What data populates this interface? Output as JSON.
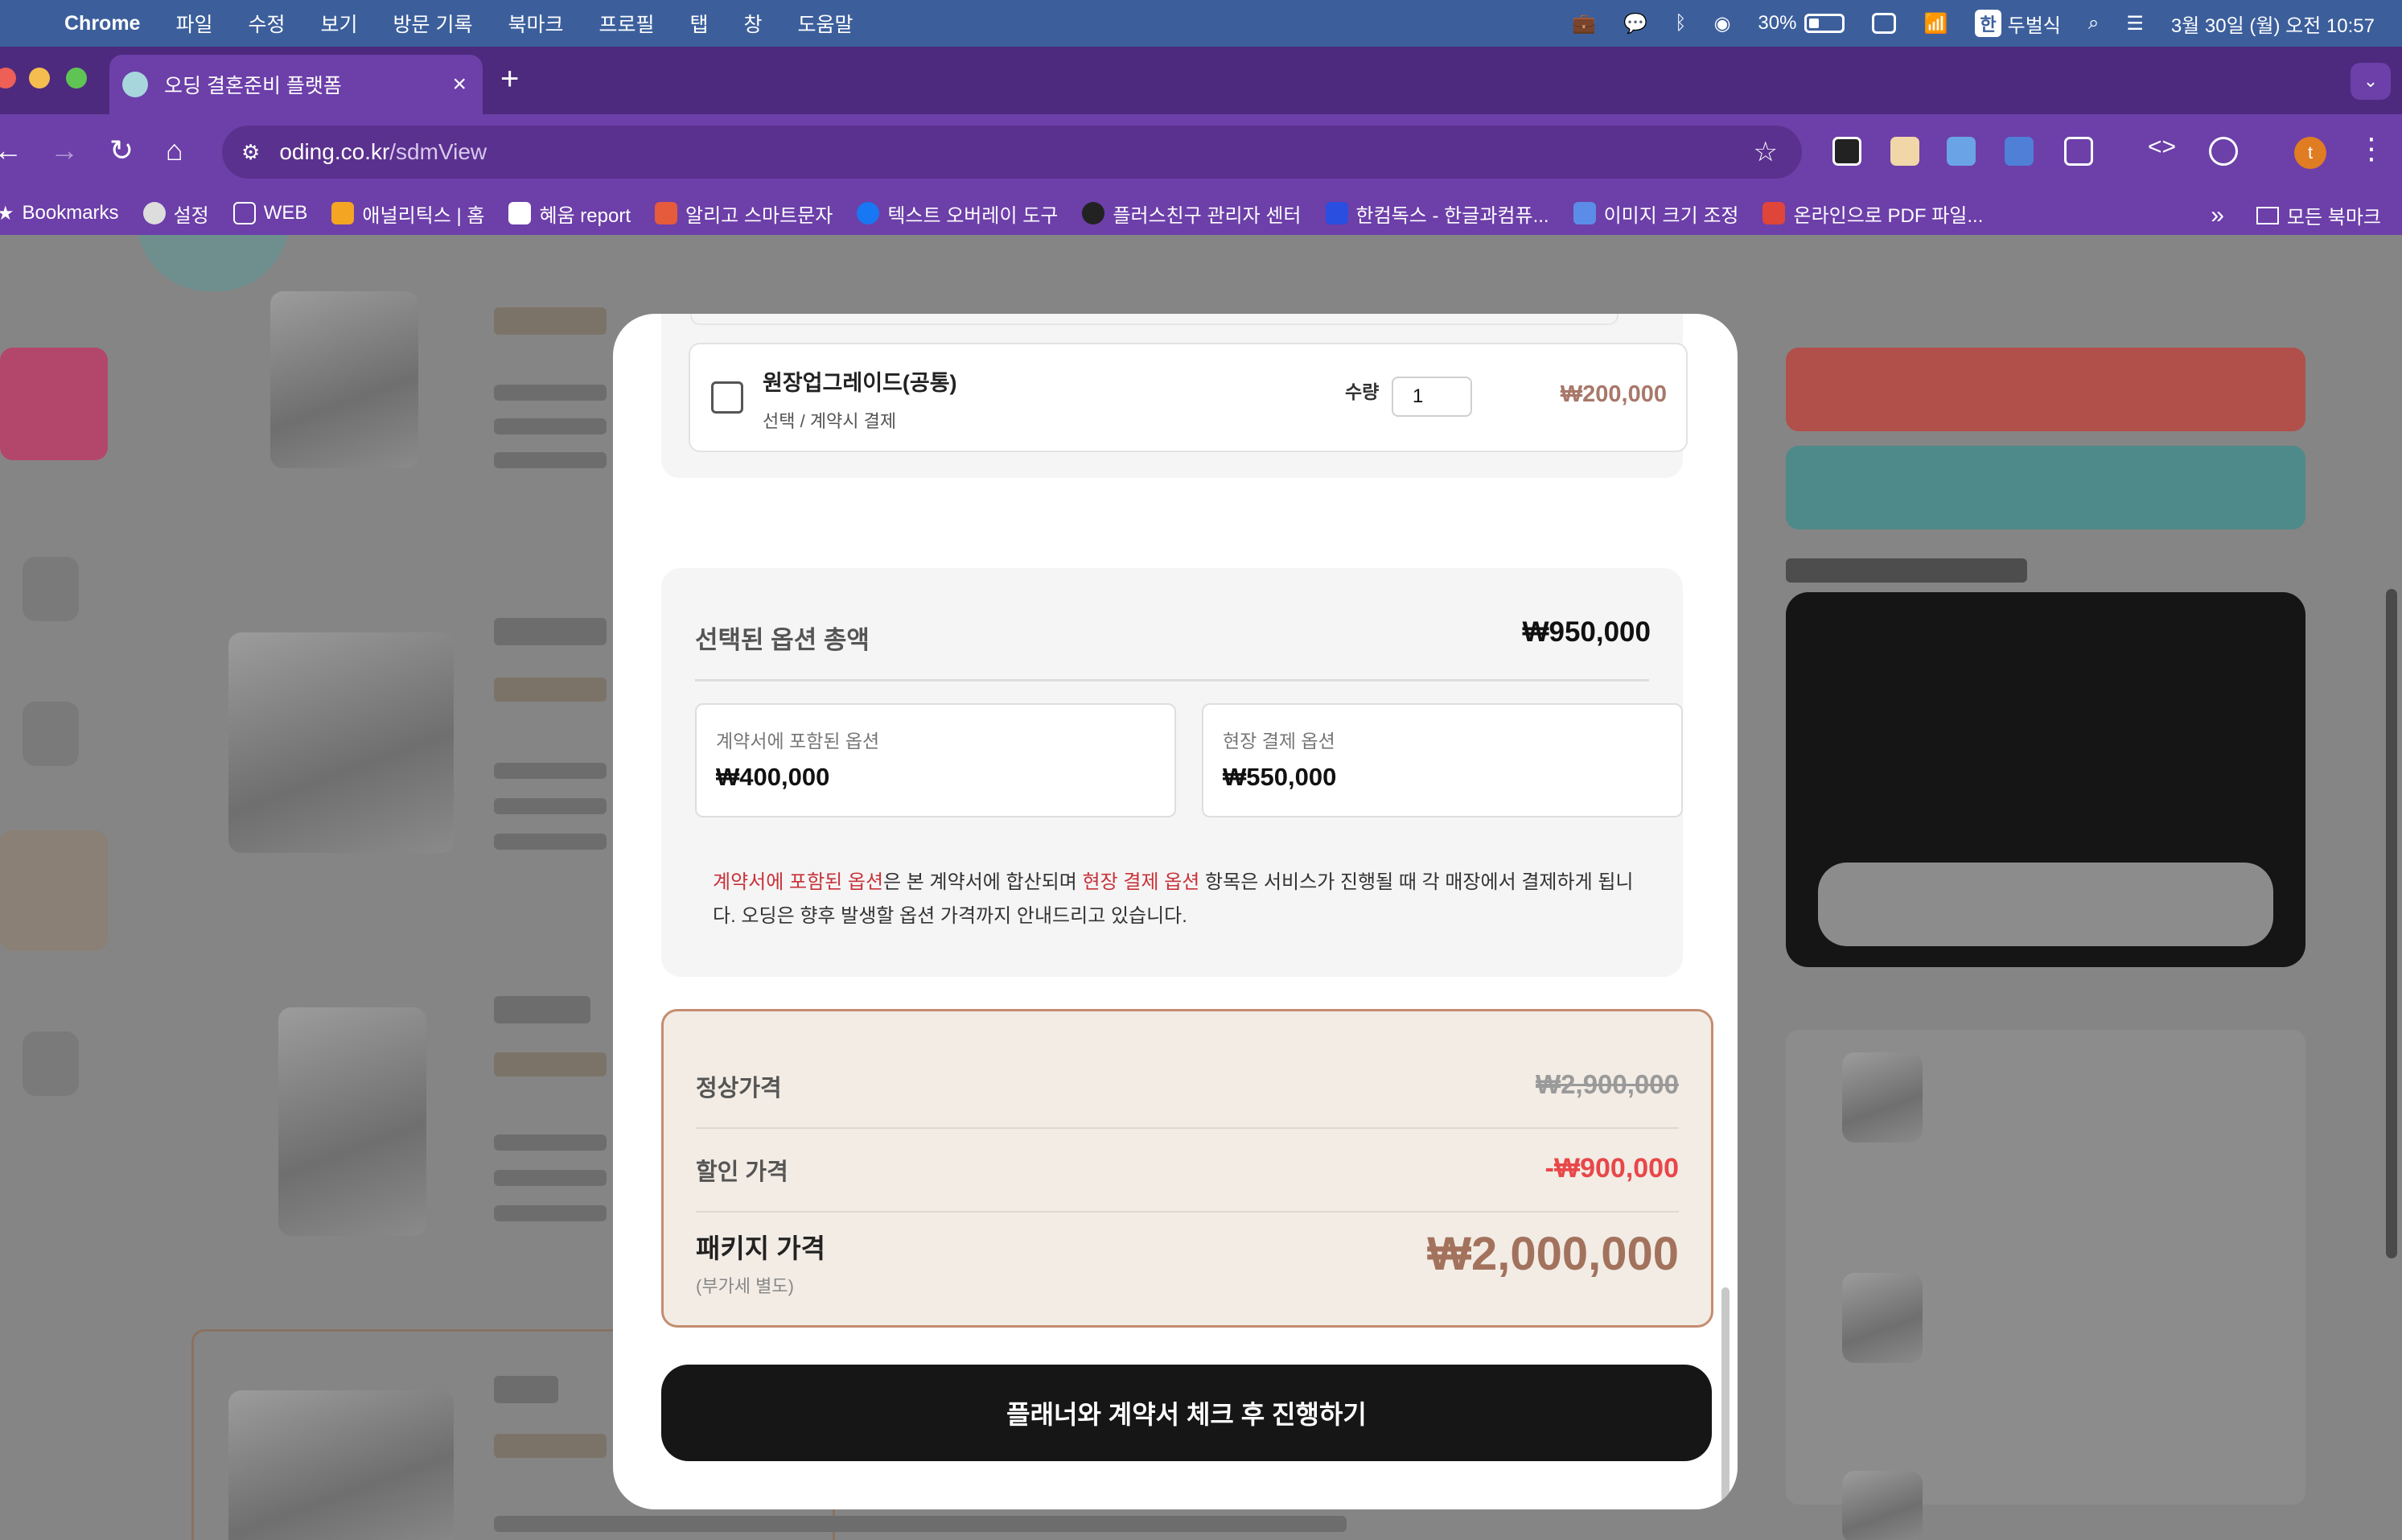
{
  "menubar": {
    "app": "Chrome",
    "menus": [
      "파일",
      "수정",
      "보기",
      "방문 기록",
      "북마크",
      "프로필",
      "탭",
      "창",
      "도움말"
    ],
    "battery": "30%",
    "input_badge": "한",
    "input_method": "두벌식",
    "datetime": "3월 30일 (월) 오전 10:57"
  },
  "tab": {
    "title": "오딩 결혼준비 플랫폼",
    "close": "×",
    "new": "+"
  },
  "toolbar": {
    "url_host": "oding.co.kr",
    "url_path": "/sdmView",
    "profile_initial": "t",
    "back": "←",
    "forward": "→",
    "reload": "↻",
    "home": "⌂",
    "star": "☆",
    "menu": "⋮"
  },
  "bookmarks": {
    "items": [
      "Bookmarks",
      "설정",
      "WEB",
      "애널리틱스 | 홈",
      "혜움 report",
      "알리고 스마트문자",
      "텍스트 오버레이 도구",
      "플러스친구 관리자 센터",
      "한컴독스 - 한글과컴퓨...",
      "이미지 크기 조정",
      "온라인으로 PDF 파일..."
    ],
    "overflow": "»",
    "all": "모든 북마크"
  },
  "option": {
    "title": "원장업그레이드(공통)",
    "meta": "선택  / 계약시 결제",
    "qty_label": "수량",
    "qty_value": "1",
    "price": "₩200,000"
  },
  "summary": {
    "title": "선택된 옵션 총액",
    "total": "₩950,000",
    "contract_label": "계약서에 포함된 옵션",
    "contract_value": "₩400,000",
    "onsite_label": "현장 결제 옵션",
    "onsite_value": "₩550,000",
    "note_hl1": "계약서에 포함된 옵션",
    "note_mid": "은 본 계약서에 합산되며 ",
    "note_hl2": "현장 결제 옵션",
    "note_end": " 항목은 서비스가 진행될 때 각 매장에서 결제하게 됩니다. 오딩은 향후 발생할 옵션 가격까지 안내드리고 있습니다."
  },
  "pricing": {
    "regular_label": "정상가격",
    "regular_value": "₩2,900,000",
    "discount_label": "할인 가격",
    "discount_value": "-₩900,000",
    "package_label": "패키지 가격",
    "package_sub": "(부가세 별도)",
    "package_value": "₩2,000,000"
  },
  "cta": {
    "label": "플래너와 계약서 체크 후 진행하기"
  },
  "colors": {
    "accent": "#a3725d",
    "discount": "#e8474a",
    "highlight": "#c8323a",
    "border": "#c48d70"
  }
}
